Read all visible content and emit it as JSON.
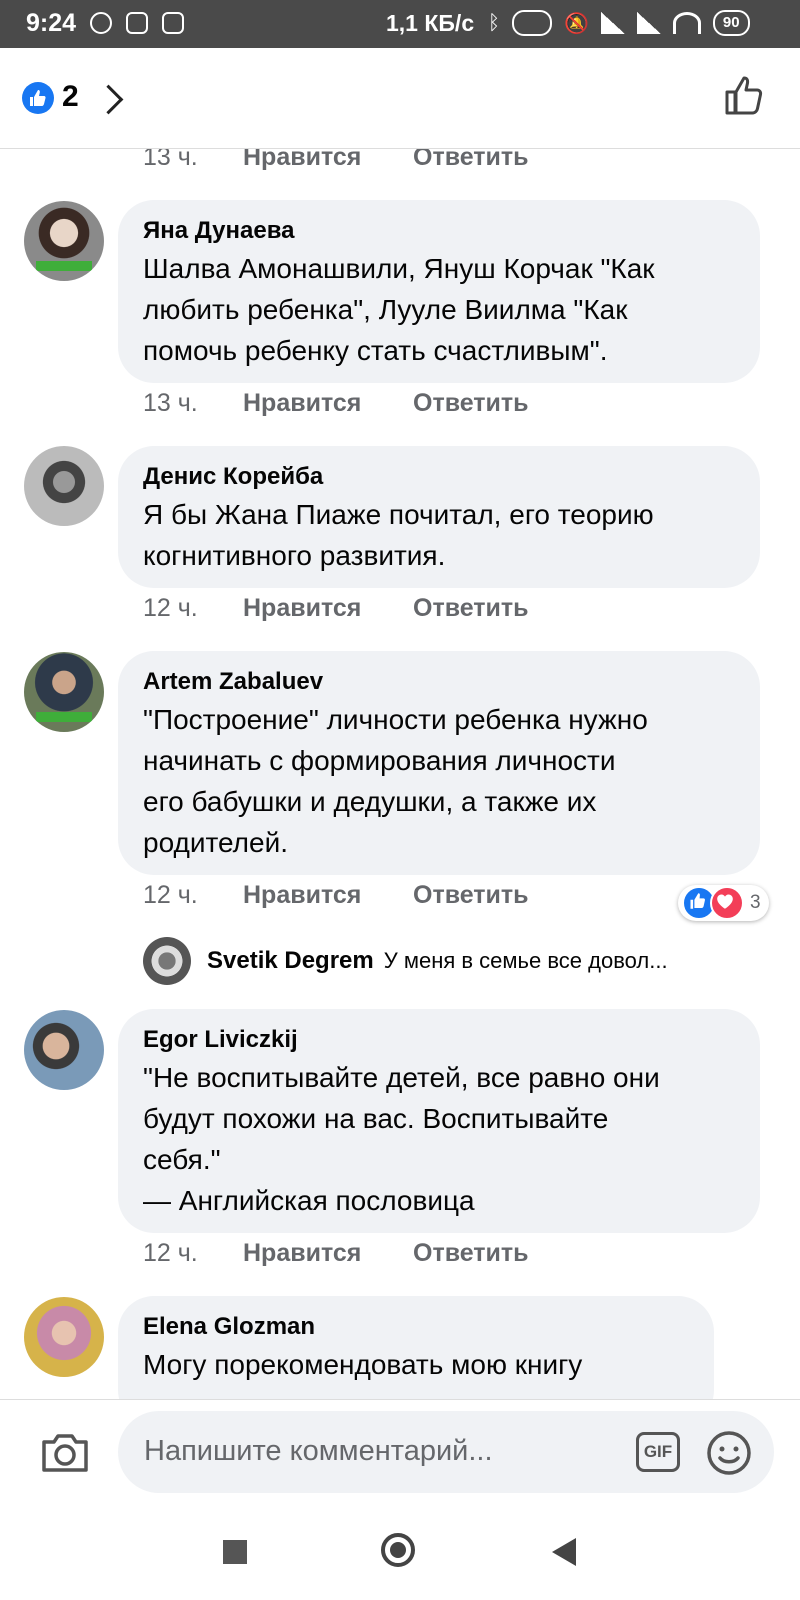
{
  "status_bar": {
    "time": "9:24",
    "speed": "1,1 КБ/с",
    "battery": "90"
  },
  "header": {
    "like_count": "2"
  },
  "comments": [
    {
      "name": "Яна Дунаева",
      "text": "Шалва Амонашвили, Януш Корчак \"Как\nлюбить ребенка\", Лууле Виилма \"Как\nпомочь ребенку стать счастливым\".",
      "time": "13 ч.",
      "like": "Нравится",
      "reply": "Ответить"
    },
    {
      "name": "Денис Корейба",
      "text": "Я бы Жана Пиаже почитал, его теорию\nкогнитивного развития.",
      "time": "12 ч.",
      "like": "Нравится",
      "reply": "Ответить"
    },
    {
      "name": "Artem Zabaluev",
      "text": "\"Построение\" личности ребенка нужно\nначинать с формирования личности\nего бабушки и дедушки, а также их\nродителей.",
      "time": "12 ч.",
      "like": "Нравится",
      "reply": "Ответить",
      "reactions": "3"
    },
    {
      "name": "Egor Liviczkij",
      "text": "\"Не воспитывайте детей, все равно они\nбудут похожи на вас. Воспитывайте\nсебя.\"\n— Английская пословица",
      "time": "12 ч.",
      "like": "Нравится",
      "reply": "Ответить"
    },
    {
      "name": "Elena Glozman",
      "text": "Могу порекомендовать мою книгу"
    }
  ],
  "top_meta": {
    "time": "13 ч.",
    "like": "Нравится",
    "reply": "Ответить"
  },
  "reply_preview": {
    "name": "Svetik Degrem",
    "text": "У меня в семье все довол..."
  },
  "composer": {
    "placeholder": "Напишите комментарий...",
    "gif": "GIF"
  },
  "colors": {
    "accent": "#1877f2",
    "bubble": "#f0f2f5",
    "meta": "#65676b",
    "heart": "#f33e58"
  }
}
